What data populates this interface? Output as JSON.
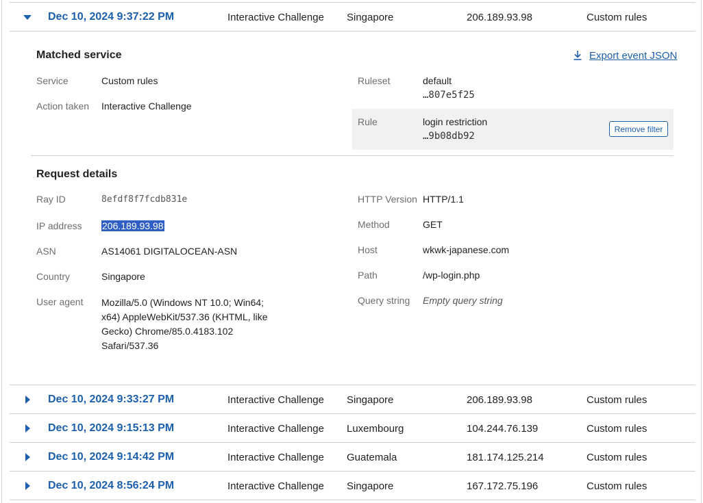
{
  "expanded_event": {
    "date": "Dec 10, 2024 9:37:22 PM",
    "action": "Interactive Challenge",
    "country": "Singapore",
    "ip": "206.189.93.98",
    "service": "Custom rules"
  },
  "matched_service": {
    "title": "Matched service",
    "export_label": "Export event JSON",
    "service_label": "Service",
    "service_value": "Custom rules",
    "action_label": "Action taken",
    "action_value": "Interactive Challenge",
    "ruleset_label": "Ruleset",
    "ruleset_name": "default",
    "ruleset_id": "…807e5f25",
    "rule_label": "Rule",
    "rule_name": "login restriction",
    "rule_id": "…9b08db92",
    "remove_filter_label": "Remove filter"
  },
  "request_details": {
    "title": "Request details",
    "ray_id_label": "Ray ID",
    "ray_id_value": "8efdf8f7fcdb831e",
    "ip_label": "IP address",
    "ip_value": "206.189.93.98",
    "asn_label": "ASN",
    "asn_value": "AS14061 DIGITALOCEAN-ASN",
    "country_label": "Country",
    "country_value": "Singapore",
    "user_agent_label": "User agent",
    "user_agent_lines": [
      "Mozilla/5.0 (Windows NT 10.0; Win64;",
      "x64) AppleWebKit/537.36 (KHTML, like",
      "Gecko) Chrome/85.0.4183.102",
      "Safari/537.36"
    ],
    "http_version_label": "HTTP Version",
    "http_version_value": "HTTP/1.1",
    "method_label": "Method",
    "method_value": "GET",
    "host_label": "Host",
    "host_value": "wkwk-japanese.com",
    "path_label": "Path",
    "path_value": "/wp-login.php",
    "query_label": "Query string",
    "query_value": "Empty query string"
  },
  "events": [
    {
      "date": "Dec 10, 2024 9:33:27 PM",
      "action": "Interactive Challenge",
      "country": "Singapore",
      "ip": "206.189.93.98",
      "service": "Custom rules"
    },
    {
      "date": "Dec 10, 2024 9:15:13 PM",
      "action": "Interactive Challenge",
      "country": "Luxembourg",
      "ip": "104.244.76.139",
      "service": "Custom rules"
    },
    {
      "date": "Dec 10, 2024 9:14:42 PM",
      "action": "Interactive Challenge",
      "country": "Guatemala",
      "ip": "181.174.125.214",
      "service": "Custom rules"
    },
    {
      "date": "Dec 10, 2024 8:56:24 PM",
      "action": "Interactive Challenge",
      "country": "Singapore",
      "ip": "167.172.75.196",
      "service": "Custom rules"
    }
  ],
  "colors": {
    "link_blue": "#1b5fad",
    "selection_blue": "#2f5ec4",
    "rule_box_bg": "#f1f1f1"
  }
}
